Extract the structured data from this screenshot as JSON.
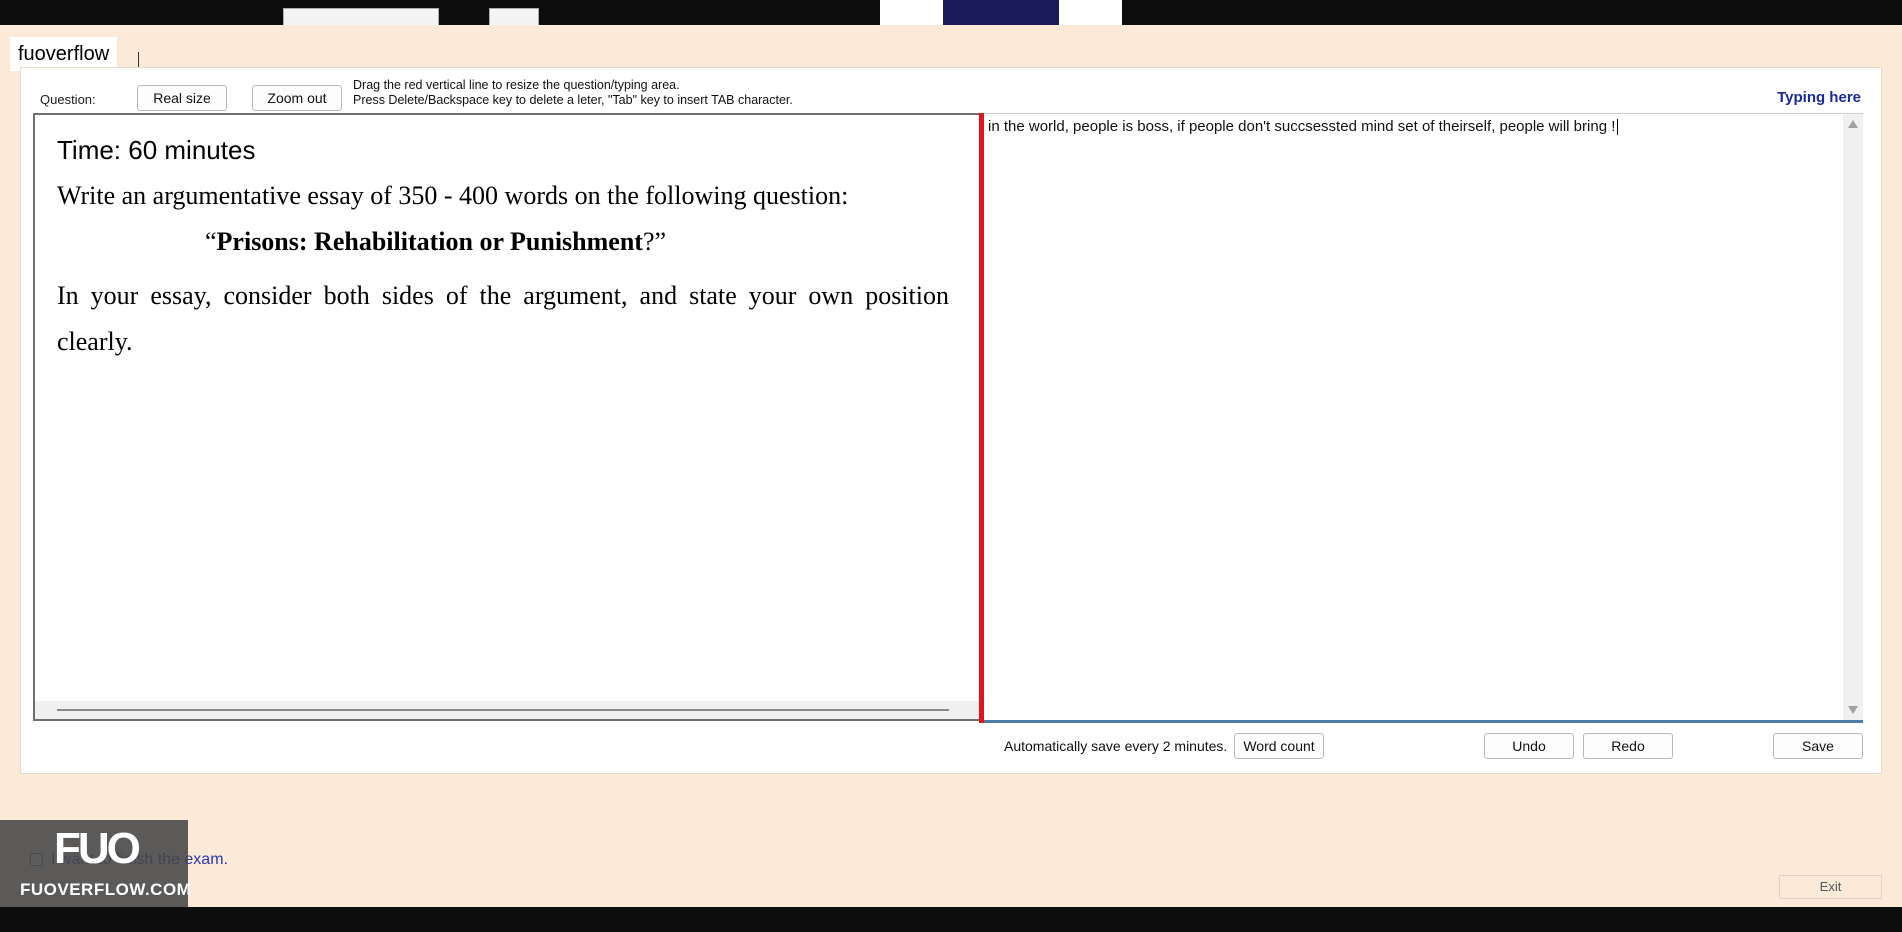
{
  "watermark_top": "fuoverflow",
  "question_toolbar": {
    "label": "Question:",
    "real_size": "Real size",
    "zoom_out": "Zoom out",
    "hint_line1": "Drag the red vertical line to resize the question/typing area.",
    "hint_line2": "Press Delete/Backspace key to delete a leter, \"Tab\" key to insert TAB character.",
    "typing_here": "Typing here"
  },
  "question": {
    "time": "Time: 60 minutes",
    "instruction": "Write an argumentative essay of 350 - 400 words on the following question:",
    "topic_open": "“",
    "topic_bold": "Prisons: Rehabilitation or Punishment",
    "topic_close": "?”",
    "essay_note": "In your essay, consider both sides of the argument, and state your own position clearly."
  },
  "typing": {
    "text": "in the world, people is boss, if people don't succsessted mind set of theirself, people will bring !"
  },
  "footer": {
    "autosave": "Automatically save every 2 minutes.",
    "word_count": "Word count",
    "undo": "Undo",
    "redo": "Redo",
    "save": "Save"
  },
  "finish": {
    "label": "I want to finish the exam."
  },
  "logo": {
    "mark": "FUO",
    "site": "FUOVERFLOW.COM"
  },
  "exit": "Exit",
  "colors": {
    "background": "#fbead8",
    "divider": "#e0141b",
    "typing_here": "#1a2a9a",
    "finish_text": "#2838b8"
  }
}
